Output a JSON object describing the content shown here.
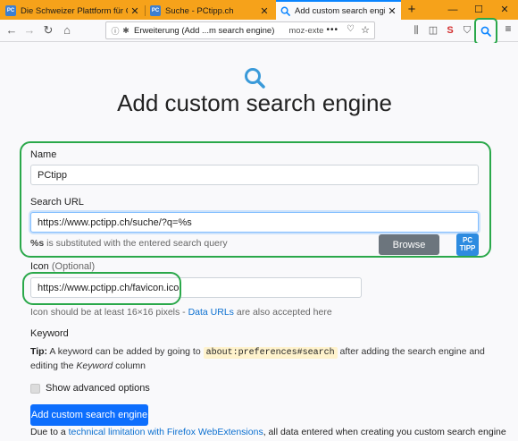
{
  "browser": {
    "tabs": [
      {
        "title": "Die Schweizer Plattform für Co",
        "icon": "pctipp-favicon"
      },
      {
        "title": "Suche - PCtipp.ch",
        "icon": "pctipp-favicon"
      },
      {
        "title": "Add custom search engine",
        "icon": "search-icon"
      }
    ],
    "favicon_text": "PC",
    "close_glyph": "✕",
    "new_tab_glyph": "+",
    "window_controls": {
      "minimize": "—",
      "maximize": "☐",
      "close": "✕"
    },
    "urlbar": {
      "label": "Erweiterung (Add ...m search engine)",
      "path": "moz-exte",
      "more": "•••"
    },
    "highlight_color": "#2aa84a",
    "accent_color": "#f6a21a"
  },
  "page": {
    "heading": "Add custom search engine",
    "name": {
      "label": "Name",
      "value": "PCtipp"
    },
    "search_url": {
      "label": "Search URL",
      "value": "https://www.pctipp.ch/suche/?q=%s",
      "hint_bold": "%s",
      "hint_rest": " is substituted with the entered search query"
    },
    "icon": {
      "label": "Icon",
      "optional": "(Optional)",
      "value": "https://www.pctipp.ch/favicon.ico",
      "browse": "Browse",
      "logo_line1": "PC",
      "logo_line2": "TIPP",
      "hint_text": "Icon should be at least 16×16 pixels - ",
      "hint_link": "Data URLs",
      "hint_end": " are also accepted here"
    },
    "keyword": {
      "label": "Keyword",
      "tip_label": "Tip:",
      "tip_text1": " A keyword can be added by going to ",
      "tip_code": "about:preferences#search",
      "tip_text2": " after adding the search engine and editing the ",
      "tip_em": "Keyword",
      "tip_text3": " column"
    },
    "advanced_label": "Show advanced options",
    "submit": "Add custom search engine",
    "footer_text1": "Due to a ",
    "footer_link": "technical limitation with Firefox WebExtensions",
    "footer_text2": ", all data entered when creating you custom search engine"
  }
}
